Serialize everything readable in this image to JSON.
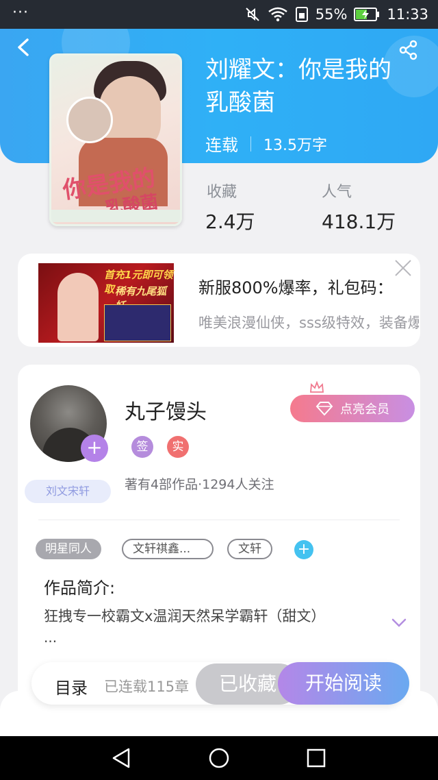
{
  "status_bar": {
    "overflow": "···",
    "battery": "55%",
    "time": "11:33"
  },
  "book": {
    "title": "刘耀文：你是我的乳酸菌",
    "status": "连载",
    "word_count": "13.5万字",
    "stats": [
      {
        "label": "收藏",
        "value": "2.4万"
      },
      {
        "label": "人气",
        "value": "418.1万"
      }
    ]
  },
  "cover": {
    "text_line1": "你是我的",
    "text_line2": "乳酸菌"
  },
  "ad": {
    "title": "新服800%爆率，礼包码：",
    "description": "唯美浪漫仙侠，sss级特效，装备爆",
    "image_text1": "首充1元即可领取",
    "image_text2": "稀有九尾狐妖"
  },
  "author": {
    "name": "丸子馒头",
    "badge_sign": "签",
    "badge_real": "实",
    "fan_badge": "刘文宋轩",
    "stats": "著有4部作品·1294人关注",
    "vip_label": "点亮会员"
  },
  "tags": [
    "明星同人",
    "文轩祺鑫...",
    "文轩"
  ],
  "intro": {
    "label": "作品简介:",
    "text": "狂拽专一校霸文x温润天然呆学霸轩（甜文）",
    "more": "..."
  },
  "bottom": {
    "toc_label": "目录",
    "toc_count": "已连载115章",
    "favorited_label": "已收藏",
    "read_label": "开始阅读"
  },
  "colors": {
    "header_blue": "#2fb0f6",
    "read_gradient_start": "#b487e8",
    "read_gradient_end": "#6aa9f0",
    "vip_gradient_start": "#f57a8d"
  }
}
